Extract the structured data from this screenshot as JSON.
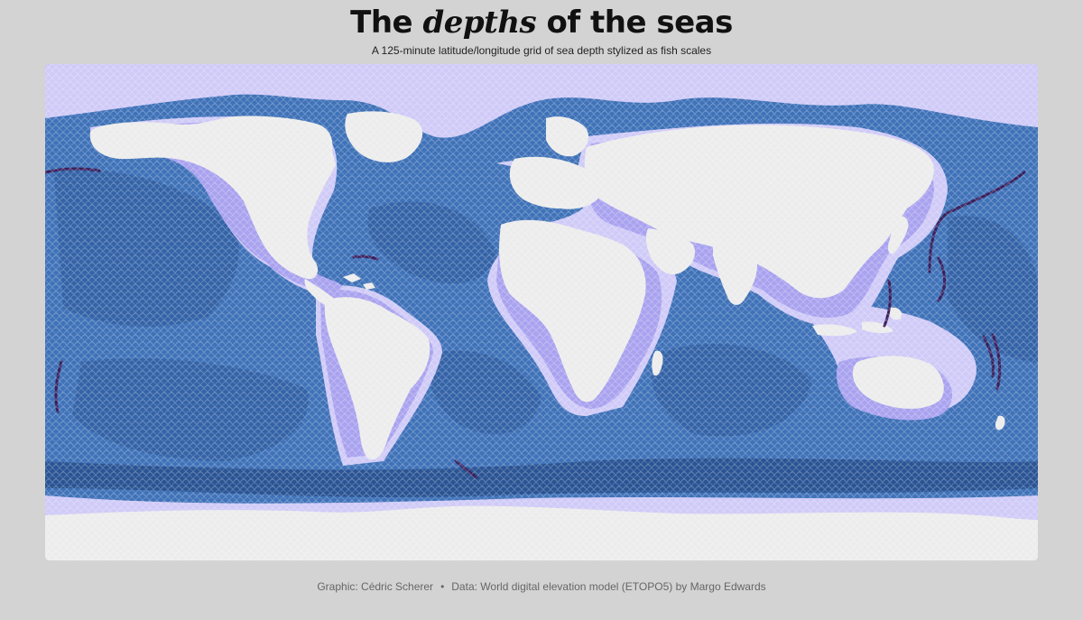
{
  "header": {
    "title_pre": "The",
    "title_em": "depths",
    "title_post": "of the seas",
    "subtitle": "A 125-minute latitude/longitude grid of sea depth stylized as fish scales"
  },
  "caption": {
    "credit": "Graphic: Cédric Scherer",
    "separator": "•",
    "source": "Data: World digital elevation model (ETOPO5) by Margo Edwards"
  },
  "map": {
    "palette": {
      "land": "#ececec",
      "shelf_light": "#cfcaf7",
      "shelf": "#a9a2ef",
      "slope": "#7b86d8",
      "ocean": "#3f72b8",
      "ocean_deep": "#3463a7",
      "abyss": "#2a5494",
      "trench": "#3a1f5c",
      "scale_edge": "#ffffff"
    }
  }
}
